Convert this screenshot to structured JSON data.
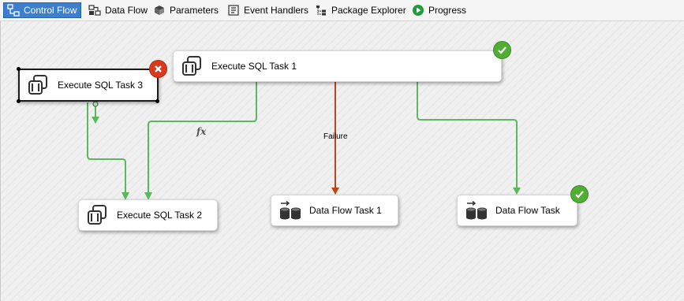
{
  "tabs": [
    {
      "label": "Control Flow",
      "icon": "control-flow-icon",
      "active": true
    },
    {
      "label": "Data Flow",
      "icon": "data-flow-icon"
    },
    {
      "label": "Parameters",
      "icon": "parameters-icon"
    },
    {
      "label": "Event Handlers",
      "icon": "event-handlers-icon"
    },
    {
      "label": "Package Explorer",
      "icon": "package-explorer-icon"
    },
    {
      "label": "Progress",
      "icon": "progress-icon"
    }
  ],
  "tasks": {
    "sql1": {
      "label": "Execute SQL Task 1",
      "icon": "execute-sql-icon",
      "status": "success"
    },
    "sql3": {
      "label": "Execute SQL Task 3",
      "icon": "execute-sql-icon",
      "status": "failure",
      "selected": true
    },
    "sql2": {
      "label": "Execute SQL Task 2",
      "icon": "execute-sql-icon"
    },
    "df1": {
      "label": "Data Flow Task 1",
      "icon": "data-flow-task-icon"
    },
    "df": {
      "label": "Data Flow Task",
      "icon": "data-flow-task-icon",
      "status": "success"
    }
  },
  "connectors": {
    "failure_label": "Failure",
    "expression_label": "fx"
  },
  "colors": {
    "success": "#5cb85c",
    "failure": "#c0441a",
    "active_tab": "#3d7fcf"
  }
}
